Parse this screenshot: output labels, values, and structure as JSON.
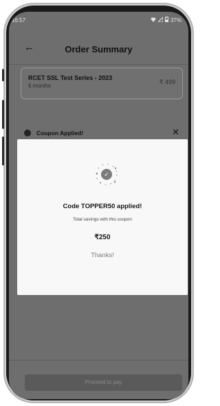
{
  "status_bar": {
    "time": "16:57",
    "icons": [
      "wifi-icon",
      "signal-icon",
      "battery-icon"
    ],
    "battery": "37%"
  },
  "header": {
    "title": "Order Summary",
    "back_icon": "arrow-left-icon"
  },
  "product": {
    "name": "RCET SSL Test Series - 2023",
    "duration": "6 months",
    "price": "₹ 499"
  },
  "coupon_banner": {
    "label": "Coupon Applied!",
    "icon": "coupon-icon",
    "close_icon": "close-icon"
  },
  "modal": {
    "title": "Code TOPPER50  applied!",
    "subtitle": "Total savings with this coupon",
    "amount": "₹250",
    "thanks": "Thanks!"
  },
  "footer": {
    "pay_label": "Proceed to pay"
  },
  "colors": {
    "overlay": "#6e6e6e",
    "modal_bg": "#f8f8f8",
    "button_disabled": "#5a5a5a"
  }
}
